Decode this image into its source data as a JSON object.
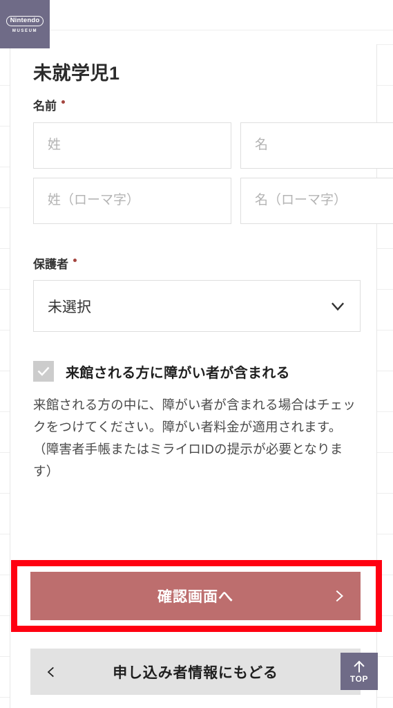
{
  "brand": {
    "logo_text": "Nintendo",
    "logo_sub": "MUSEUM"
  },
  "form": {
    "title": "未就学児1",
    "name_label": "名前",
    "name_fields": [
      {
        "placeholder": "姓",
        "value": ""
      },
      {
        "placeholder": "名",
        "value": ""
      },
      {
        "placeholder": "姓（ローマ字）",
        "value": ""
      },
      {
        "placeholder": "名（ローマ字）",
        "value": ""
      }
    ],
    "guardian_label": "保護者",
    "guardian_selected": "未選択",
    "disability_checkbox_label": "来館される方に障がい者が含まれる",
    "disability_help_text": "来館される方の中に、障がい者が含まれる場合はチェックをつけてください。障がい者料金が適用されます。（障害者手帳またはミライロIDの提示が必要となります）"
  },
  "actions": {
    "submit_label": "確認画面へ",
    "back_label": "申し込み者情報にもどる",
    "scroll_top_label": "TOP"
  },
  "colors": {
    "brand_purple": "#6f6b87",
    "primary_button": "#bd6e6e",
    "annotation_red": "#ff0011",
    "back_button_gray": "#e2e2e2",
    "required_dot": "#a4453f"
  }
}
